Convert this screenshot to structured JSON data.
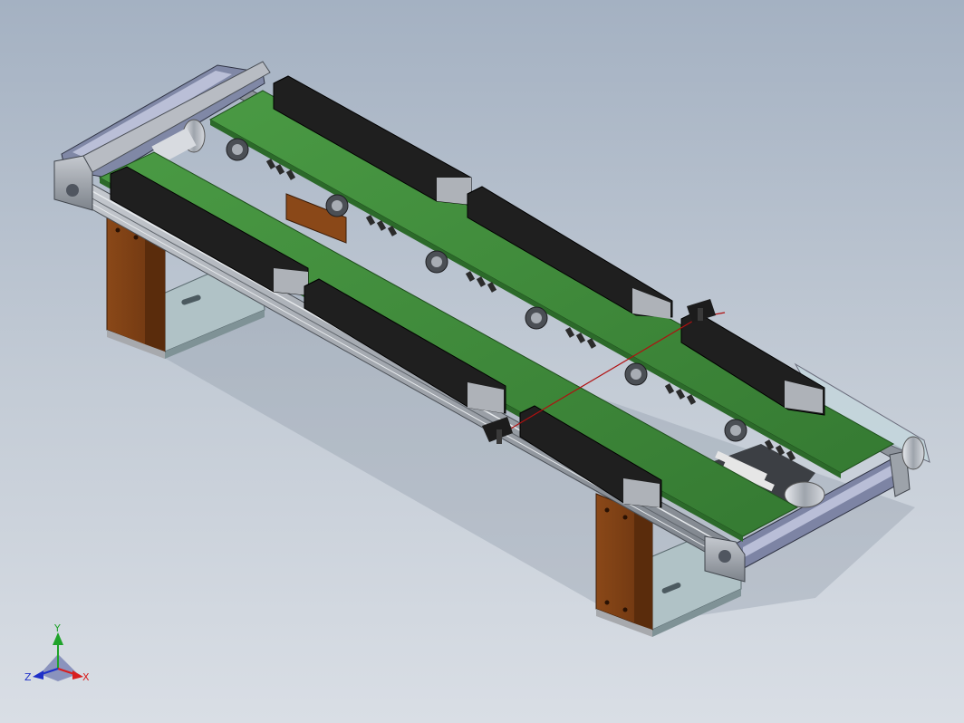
{
  "viewport": {
    "background_top": "#a4b1c2",
    "background_bottom": "#d9dee5"
  },
  "model": {
    "name": "dual-belt-conveyor",
    "colors": {
      "belt": "#3e8a3a",
      "belt_edge": "#2c6a2a",
      "guide_rail": "#1c1c1c",
      "frame": "#9aa0a8",
      "leg_block": "#7a3e14",
      "base_plate": "#a9bcc0",
      "end_plate": "#b4b8c0",
      "sensor_beam": "#b01010"
    }
  },
  "triad": {
    "x_label": "X",
    "y_label": "Y",
    "z_label": "Z",
    "x_color": "#d81e1e",
    "y_color": "#1fa32a",
    "z_color": "#1e2fc8"
  }
}
